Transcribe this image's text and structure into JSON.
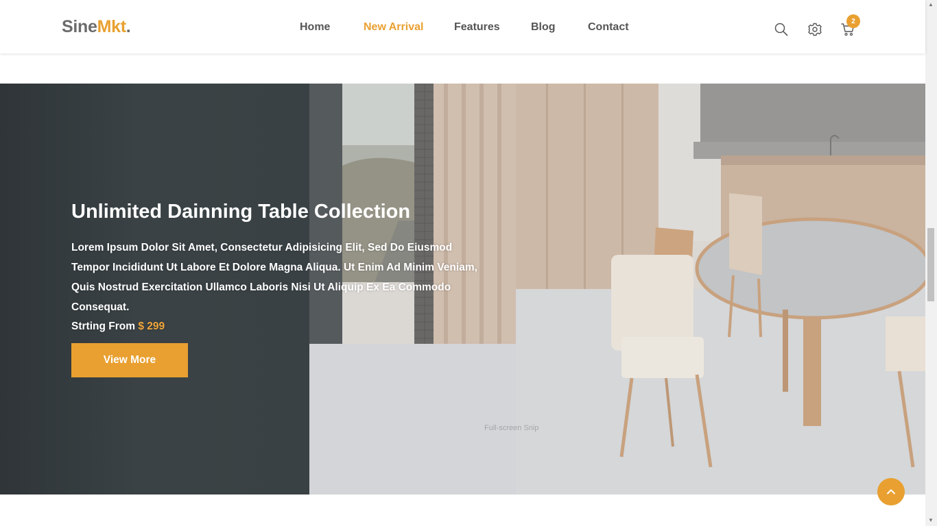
{
  "header": {
    "logo": {
      "part1": "Sine",
      "part2": "Mkt",
      "part3": "."
    },
    "nav": [
      {
        "label": "Home",
        "active": false
      },
      {
        "label": "New Arrival",
        "active": true
      },
      {
        "label": "Features",
        "active": false
      },
      {
        "label": "Blog",
        "active": false
      },
      {
        "label": "Contact",
        "active": false
      }
    ],
    "icons": [
      "search-icon",
      "gear-icon",
      "cart-icon"
    ],
    "cart_count": "2"
  },
  "hero": {
    "title": "Unlimited Dainning Table Collection",
    "description": "Lorem Ipsum Dolor Sit Amet, Consectetur Adipisicing Elit, Sed Do Eiusmod Tempor Incididunt Ut Labore Et Dolore Magna Aliqua. Ut Enim Ad Minim Veniam, Quis Nostrud Exercitation Ullamco Laboris Nisi Ut Aliquip Ex Ea Commodo Consequat.",
    "price_label": "Strting From",
    "price_value": "$ 299",
    "button_label": "View More"
  },
  "overlay_text": "Full-screen Snip",
  "colors": {
    "accent": "#e9a030",
    "dark_panel": "#394144",
    "nav_text": "#555555"
  }
}
